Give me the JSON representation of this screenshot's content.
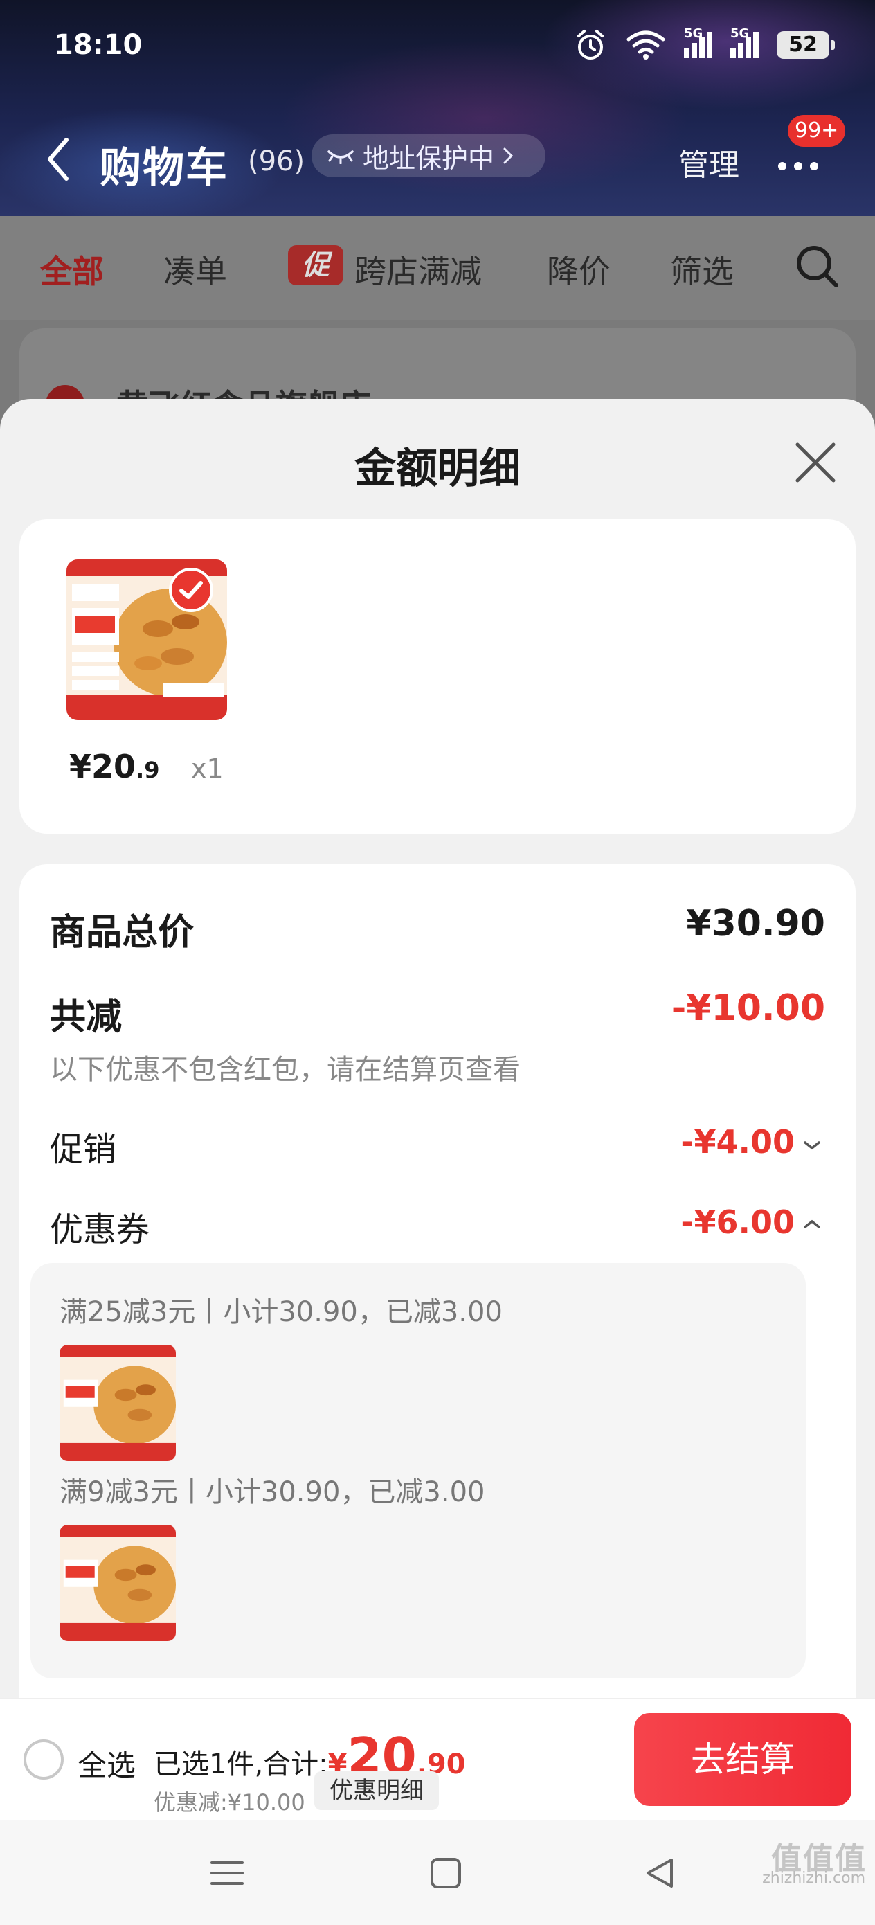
{
  "status_bar": {
    "time": "18:10",
    "network_1": "5G",
    "network_2": "5G",
    "battery": "52"
  },
  "header": {
    "title": "购物车",
    "count": "(96)",
    "address_protection": "地址保护中",
    "manage": "管理",
    "more_badge": "99+"
  },
  "filters": {
    "all": "全部",
    "bundle": "凑单",
    "promo_tag": "促",
    "cross_store": "跨店满减",
    "price_drop": "降价",
    "filter": "筛选"
  },
  "store": {
    "name": "黄飞红食品旗舰店"
  },
  "sheet": {
    "title": "金额明细",
    "item": {
      "price_int": "¥20",
      "price_dec": ".9",
      "qty": "x1"
    },
    "product_total_label": "商品总价",
    "product_total_value": "¥30.90",
    "total_discount_label": "共减",
    "total_discount_value": "-¥10.00",
    "discount_note": "以下优惠不包含红包，请在结算页查看",
    "promotion_label": "促销",
    "promotion_value": "-¥4.00",
    "coupon_label": "优惠券",
    "coupon_value": "-¥6.00",
    "coupons": [
      {
        "text": "满25减3元丨小计30.90，已减3.00"
      },
      {
        "text": "满9减3元丨小计30.90，已减3.00"
      }
    ]
  },
  "bottom_bar": {
    "select_all": "全选",
    "selected_prefix": "已选1件,合计:",
    "currency": "¥",
    "total_int": "20",
    "total_frac": ".90",
    "discount_summary": "优惠减:¥10.00",
    "detail_button": "优惠明细",
    "checkout": "去结算"
  },
  "watermark": {
    "logo": "值值值",
    "url": "zhizhizhi.com"
  },
  "colors": {
    "accent_red": "#e8362f",
    "checkout_red": "#f02a35"
  }
}
